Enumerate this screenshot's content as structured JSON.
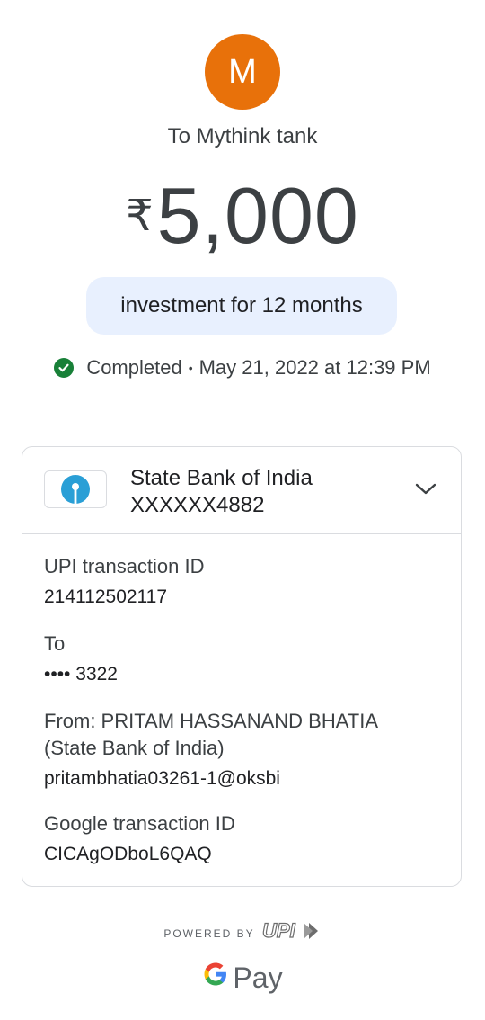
{
  "header": {
    "avatar_letter": "M",
    "avatar_color": "#e8710a",
    "recipient": "To Mythink tank",
    "currency_symbol": "₹",
    "amount": "5,000",
    "note": "investment for 12 months",
    "status": "Completed",
    "separator": "•",
    "datetime": "May 21, 2022 at 12:39 PM",
    "status_color": "#188038"
  },
  "bank": {
    "name": "State Bank of India",
    "account": "XXXXXX4882"
  },
  "details": {
    "upi_label": "UPI transaction ID",
    "upi_value": "214112502117",
    "to_label": "To",
    "to_dots": "••••",
    "to_value": "3322",
    "from_line1": "From: PRITAM HASSANAND BHATIA",
    "from_line2": "(State Bank of India)",
    "from_vpa": "pritambhatia03261-1@oksbi",
    "google_label": "Google transaction ID",
    "google_value": "CICAgODboL6QAQ"
  },
  "footer": {
    "powered_by": "POWERED BY",
    "upi_logo": "UPI",
    "gpay_text": "Pay"
  }
}
